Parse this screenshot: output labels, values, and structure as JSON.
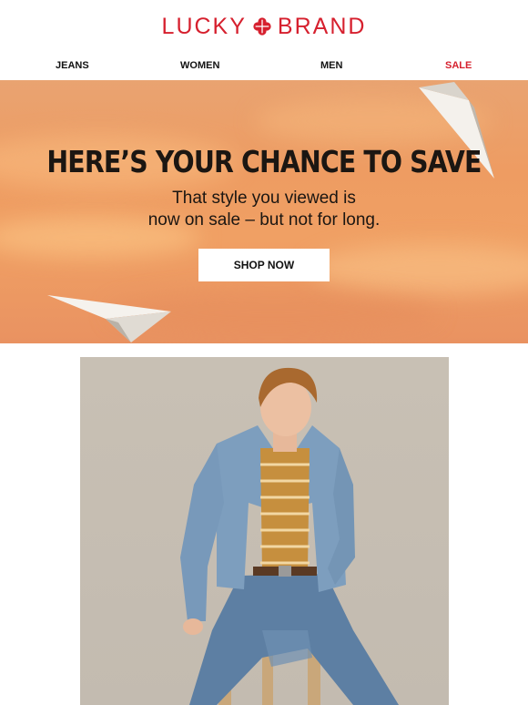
{
  "brand": {
    "logo_left": "LUCKY",
    "logo_right": "BRAND",
    "logo_icon": "clover-icon",
    "color": "#d6202e"
  },
  "nav": {
    "items": [
      {
        "label": "JEANS"
      },
      {
        "label": "WOMEN"
      },
      {
        "label": "MEN"
      },
      {
        "label": "SALE",
        "color": "#d6202e"
      }
    ]
  },
  "hero": {
    "title": "HERE’S YOUR CHANCE TO SAVE",
    "subtitle_line1": "That style you viewed is",
    "subtitle_line2": "now on sale – but not for long.",
    "cta": "SHOP NOW",
    "background": "#ee9c62"
  },
  "product": {
    "image": "man-in-denim-jacket-on-stool"
  }
}
